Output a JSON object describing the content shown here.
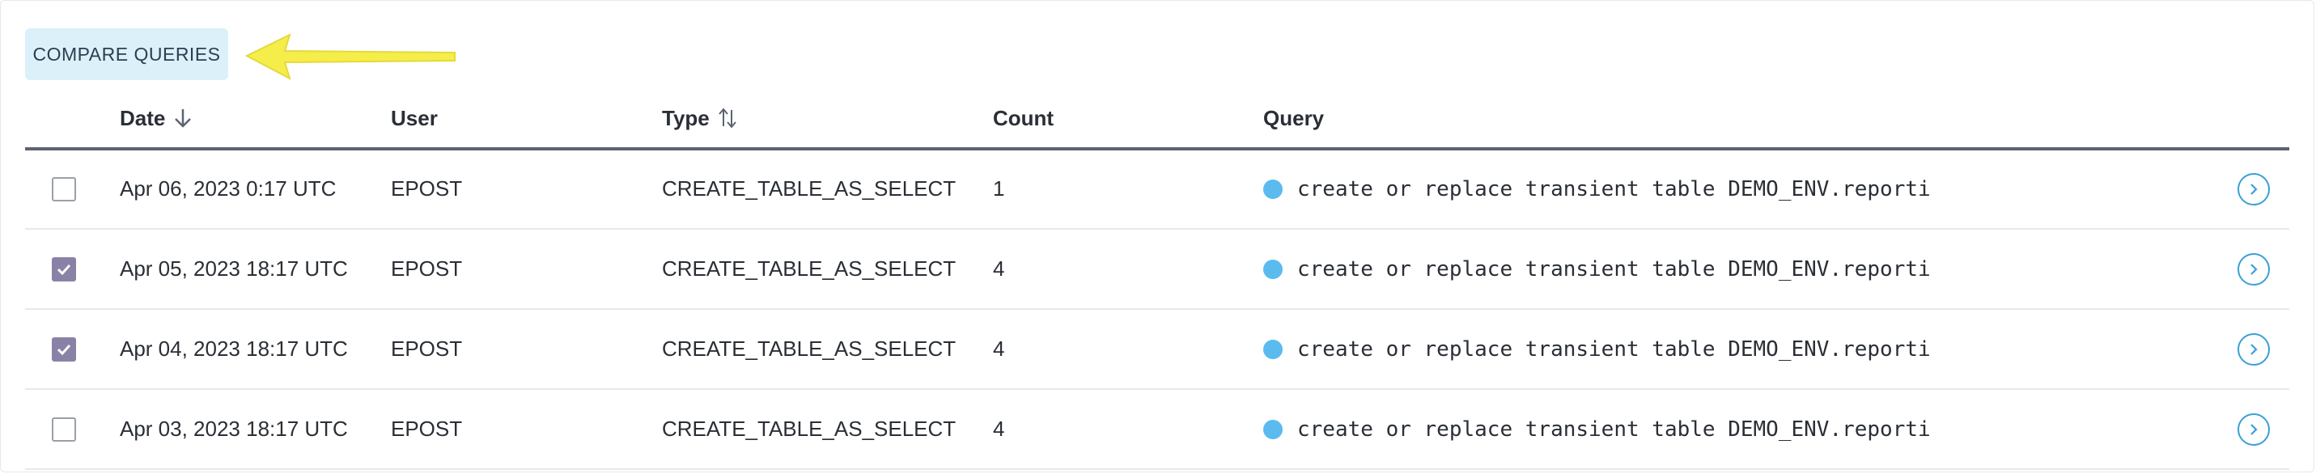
{
  "toolbar": {
    "compare_label": "COMPARE QUERIES"
  },
  "columns": {
    "date": "Date",
    "user": "User",
    "type": "Type",
    "count": "Count",
    "query": "Query"
  },
  "rows": [
    {
      "checked": false,
      "date": "Apr 06, 2023 0:17 UTC",
      "user": "EPOST",
      "type": "CREATE_TABLE_AS_SELECT",
      "count": "1",
      "query": "create or replace transient table DEMO_ENV.reporti"
    },
    {
      "checked": true,
      "date": "Apr 05, 2023 18:17 UTC",
      "user": "EPOST",
      "type": "CREATE_TABLE_AS_SELECT",
      "count": "4",
      "query": "create or replace transient table DEMO_ENV.reporti"
    },
    {
      "checked": true,
      "date": "Apr 04, 2023 18:17 UTC",
      "user": "EPOST",
      "type": "CREATE_TABLE_AS_SELECT",
      "count": "4",
      "query": "create or replace transient table DEMO_ENV.reporti"
    },
    {
      "checked": false,
      "date": "Apr 03, 2023 18:17 UTC",
      "user": "EPOST",
      "type": "CREATE_TABLE_AS_SELECT",
      "count": "4",
      "query": "create or replace transient table DEMO_ENV.reporti"
    }
  ],
  "colors": {
    "button_bg": "#dcf0fa",
    "checkbox_checked": "#8a82a6",
    "status_dot": "#5bbbef",
    "link_accent": "#3a9fd6",
    "annotation_arrow": "#f5ee4a"
  },
  "icons": {
    "sort_date": "arrow-down-icon",
    "sort_type": "sort-up-down-icon",
    "row_action": "chevron-right-circle-icon",
    "status": "status-dot-icon",
    "annotation": "arrow-left-annotation-icon"
  }
}
